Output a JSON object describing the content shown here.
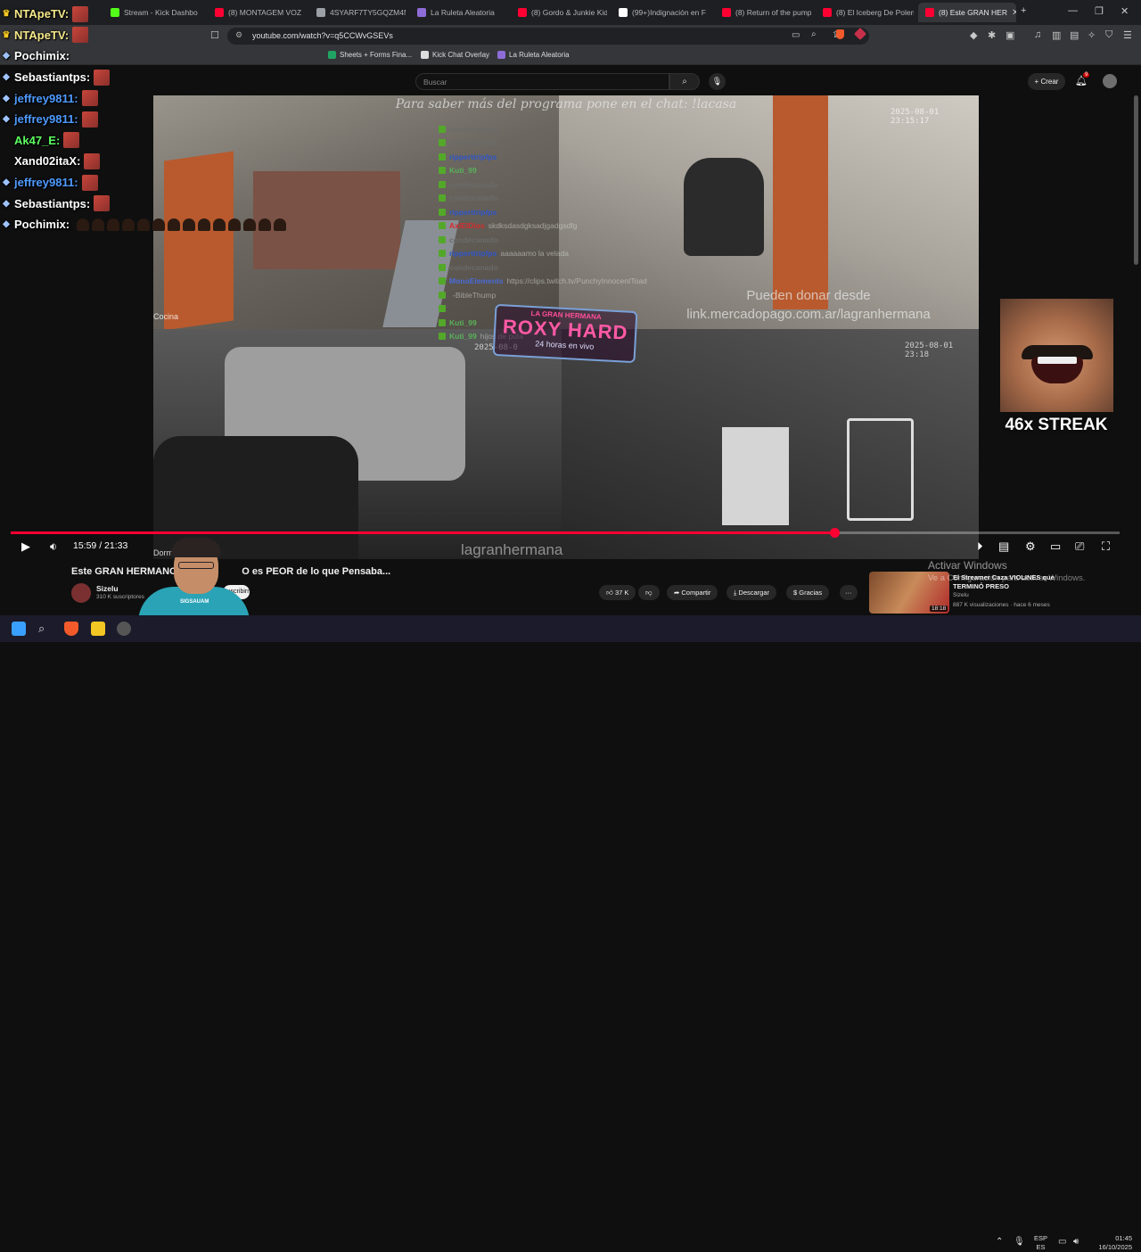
{
  "browser": {
    "tabs": [
      {
        "label": "Stream - Kick Dashbo",
        "color": "#53fc18"
      },
      {
        "label": "(8) MONTAGEM VOZ",
        "color": "#ff0033"
      },
      {
        "label": "4SYARF7TY5GQZM4M",
        "color": "#9aa0a6"
      },
      {
        "label": "La Ruleta Aleatoria",
        "color": "#8e6cd8"
      },
      {
        "label": "(8) Gordo & Junkie Kid",
        "color": "#ff0033"
      },
      {
        "label": "(99+)Indignación en F",
        "color": "#ffffff"
      },
      {
        "label": "(8) Return of the pump",
        "color": "#ff0033"
      },
      {
        "label": "(8) El Iceberg De Polem",
        "color": "#ff0033"
      },
      {
        "label": "(8) Este GRAN HER",
        "color": "#ff0033"
      }
    ],
    "new_tab": "+",
    "minimize": "—",
    "maximize": "❐",
    "close": "✕",
    "url": "youtube.com/watch?v=q5CCWvGSEVs",
    "bookmarks": [
      {
        "label": "Sheets + Forms Fina...",
        "color": "#1fa463"
      },
      {
        "label": "Kick Chat Overlay",
        "color": "#dddddd"
      },
      {
        "label": "La Ruleta Aleatoria",
        "color": "#8e6cd8"
      }
    ]
  },
  "youtube": {
    "search_placeholder": "Buscar",
    "create_label": "Crear",
    "notif_count": "9"
  },
  "video": {
    "overlay_top": "Para saber más del programa pone en el chat: !lacasa",
    "cam_kitchen_label": "Cocina",
    "cam_bed_label": "Dormi",
    "stamp_room": "2025-08-01 23:15:17",
    "stamp_yard": "2025-08-01 23:18",
    "stamp_center": "2025-08-0",
    "donate_line1": "Pueden donar desde",
    "donate_line2": "link.mercadopago.com.ar/lagranhermana",
    "watermark": "lagranhermana",
    "logo_sub": "LA GRAN HERMANA",
    "logo_title": "ROXY HARD",
    "logo_tag": "24 horas en vivo",
    "chat": [
      {
        "user": "condecanado",
        "msg": "",
        "color": "#6b6b6b"
      },
      {
        "user": "condecanado",
        "msg": "",
        "color": "#6b6b6b"
      },
      {
        "user": "ripperttripfps",
        "msg": "",
        "color": "#2f55c9"
      },
      {
        "user": "Kuti_99",
        "msg": "",
        "color": "#5ab15a"
      },
      {
        "user": "condecanado",
        "msg": "",
        "color": "#6b6b6b"
      },
      {
        "user": "condecanado",
        "msg": "",
        "color": "#6b6b6b"
      },
      {
        "user": "ripperttripfps",
        "msg": "",
        "color": "#2f55c9"
      },
      {
        "user": "AxlElDios",
        "msg": "skdksdasdgksadjgadgsdfg",
        "color": "#d42b2b"
      },
      {
        "user": "condecanado",
        "msg": "",
        "color": "#6b6b6b"
      },
      {
        "user": "ripperttripfps",
        "msg": "aaaaaamo la velada",
        "color": "#2f55c9"
      },
      {
        "user": "condecanado",
        "msg": "",
        "color": "#6b6b6b"
      },
      {
        "user": "MonoElements",
        "msg": "https://clips.twitch.tv/PunchyInnocentToad",
        "color": "#4a6ad8"
      },
      {
        "user": "",
        "msg": "-BibleThump",
        "color": "#6b6b6b"
      },
      {
        "user": "",
        "msg": "",
        "color": "#6b6b6b"
      },
      {
        "user": "Kuti_99",
        "msg": "",
        "color": "#5ab15a"
      },
      {
        "user": "Kuti_99",
        "msg": "hijos de puta",
        "color": "#5ab15a"
      }
    ]
  },
  "player": {
    "time": "15:59 / 21:33",
    "progress": 0.743
  },
  "stream_chat": [
    {
      "prefix": "♛",
      "prefix_color": "#f3c623",
      "user": "NTApeTV:",
      "color": "#f4e88a",
      "emotes": 1
    },
    {
      "prefix": "♛",
      "prefix_color": "#f3c623",
      "user": "NTApeTV:",
      "color": "#f4e88a",
      "emotes": 1
    },
    {
      "prefix": "◆",
      "prefix_color": "#9ec3ff",
      "user": "Pochimix:",
      "color": "#ffffff",
      "emotes": 0
    },
    {
      "prefix": "◆",
      "prefix_color": "#9ec3ff",
      "user": "Sebastiantps:",
      "color": "#ffffff",
      "emotes": 1
    },
    {
      "prefix": "◆",
      "prefix_color": "#9ec3ff",
      "user": "jeffrey9811:",
      "color": "#4f9bff",
      "emotes": 1
    },
    {
      "prefix": "◆",
      "prefix_color": "#9ec3ff",
      "user": "jeffrey9811:",
      "color": "#4f9bff",
      "emotes": 1
    },
    {
      "prefix": "",
      "prefix_color": "#ffffff",
      "user": "Ak47_E:",
      "color": "#5cff61",
      "emotes": 1
    },
    {
      "prefix": "",
      "prefix_color": "#ffffff",
      "user": "Xand02itaX:",
      "color": "#ffffff",
      "emotes": 1
    },
    {
      "prefix": "◆",
      "prefix_color": "#9ec3ff",
      "user": "jeffrey9811:",
      "color": "#4f9bff",
      "emotes": 1
    },
    {
      "prefix": "◆",
      "prefix_color": "#9ec3ff",
      "user": "Sebastiantps:",
      "color": "#ffffff",
      "emotes": 1
    },
    {
      "prefix": "◆",
      "prefix_color": "#9ec3ff",
      "user": "Pochimix:",
      "color": "#ffffff",
      "emotes": 0
    }
  ],
  "streak": {
    "label": "46x STREAK"
  },
  "below_video": {
    "title": "Este GRAN HERMANO CL",
    "title_end": "O es PEOR de lo que Pensaba...",
    "channel": "Sizelu",
    "subs": "310 K suscriptores",
    "subscribe": "Suscribirme",
    "likes": "37 K",
    "share": "Compartir",
    "download": "Descargar",
    "thanks": "Gracias",
    "more": "···"
  },
  "recommended": {
    "title_line1": "El Streamer Caza VIOLINES que",
    "title_line2": "TERMINÓ PRESO",
    "channel": "Sizelu",
    "views": "887 K visualizaciones · hace 6 meses",
    "duration": "18:18"
  },
  "windows_notice": {
    "line1": "Activar Windows",
    "line2": "Ve a Configuración para activar Windows."
  },
  "webcam_shirt_text": "SIGSAUAM",
  "taskbar": {
    "lang1": "ESP",
    "lang2": "ES",
    "time": "01:45",
    "date": "16/10/2025"
  }
}
